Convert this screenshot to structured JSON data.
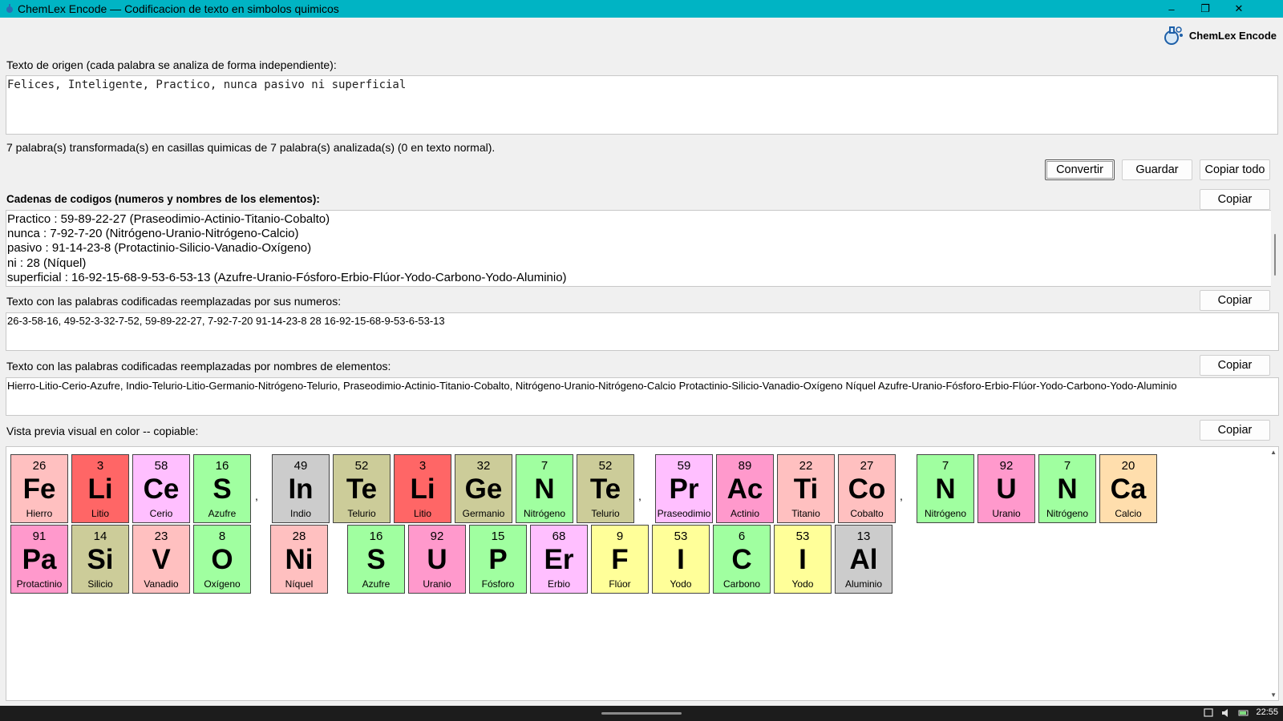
{
  "window": {
    "title": "ChemLex Encode — Codificacion de texto en simbolos quimicos",
    "controls": {
      "minimize": "–",
      "maximize": "❐",
      "close": "✕"
    }
  },
  "brand": {
    "name": "ChemLex Encode"
  },
  "source": {
    "label": "Texto de origen (cada palabra se analiza de forma independiente):",
    "value": "Felices, Inteligente, Practico, nunca pasivo ni superficial"
  },
  "status": "7 palabra(s) transformada(s) en casillas quimicas de 7 palabra(s) analizada(s) (0 en texto normal).",
  "buttons": {
    "convert": "Convertir",
    "save": "Guardar",
    "copy_all": "Copiar todo",
    "copy": "Copiar"
  },
  "codes": {
    "label": "Cadenas de codigos (numeros y nombres de los elementos):",
    "lines": [
      "Practico : 59-89-22-27  (Praseodimio-Actinio-Titanio-Cobalto)",
      "nunca : 7-92-7-20  (Nitrógeno-Uranio-Nitrógeno-Calcio)",
      "pasivo : 91-14-23-8  (Protactinio-Silicio-Vanadio-Oxígeno)",
      "ni : 28  (Níquel)",
      "superficial : 16-92-15-68-9-53-6-53-13  (Azufre-Uranio-Fósforo-Erbio-Flúor-Yodo-Carbono-Yodo-Aluminio)"
    ]
  },
  "numbers_text": {
    "label": "Texto con las palabras codificadas reemplazadas por sus numeros:",
    "value": "26-3-58-16, 49-52-3-32-7-52, 59-89-22-27, 7-92-7-20 91-14-23-8 28 16-92-15-68-9-53-6-53-13"
  },
  "names_text": {
    "label": "Texto con las palabras codificadas reemplazadas por nombres de elementos:",
    "value": "Hierro-Litio-Cerio-Azufre, Indio-Telurio-Litio-Germanio-Nitrógeno-Telurio, Praseodimio-Actinio-Titanio-Cobalto, Nitrógeno-Uranio-Nitrógeno-Calcio Protactinio-Silicio-Vanadio-Oxígeno Níquel Azufre-Uranio-Fósforo-Erbio-Flúor-Yodo-Carbono-Yodo-Aluminio"
  },
  "preview": {
    "label": "Vista previa visual en color -- copiable:",
    "colors": {
      "transition": "#ffc0c0",
      "alkali": "#ff6666",
      "lanthanide": "#ffbfff",
      "nonmetal": "#a0ffa0",
      "post_transition": "#cccccc",
      "metalloid": "#cccc99",
      "actinide": "#ff99cc",
      "alkaline_earth": "#ffdead",
      "halogen": "#ffff99"
    },
    "rows": [
      [
        {
          "n": "26",
          "s": "Fe",
          "e": "Hierro",
          "c": "transition"
        },
        {
          "n": "3",
          "s": "Li",
          "e": "Litio",
          "c": "alkali"
        },
        {
          "n": "58",
          "s": "Ce",
          "e": "Cerio",
          "c": "lanthanide"
        },
        {
          "n": "16",
          "s": "S",
          "e": "Azufre",
          "c": "nonmetal"
        },
        {
          "p": ","
        },
        {
          "n": "49",
          "s": "In",
          "e": "Indio",
          "c": "post_transition"
        },
        {
          "n": "52",
          "s": "Te",
          "e": "Telurio",
          "c": "metalloid"
        },
        {
          "n": "3",
          "s": "Li",
          "e": "Litio",
          "c": "alkali"
        },
        {
          "n": "32",
          "s": "Ge",
          "e": "Germanio",
          "c": "metalloid"
        },
        {
          "n": "7",
          "s": "N",
          "e": "Nitrógeno",
          "c": "nonmetal"
        },
        {
          "n": "52",
          "s": "Te",
          "e": "Telurio",
          "c": "metalloid"
        },
        {
          "p": ","
        },
        {
          "n": "59",
          "s": "Pr",
          "e": "Praseodimio",
          "c": "lanthanide"
        },
        {
          "n": "89",
          "s": "Ac",
          "e": "Actinio",
          "c": "actinide"
        },
        {
          "n": "22",
          "s": "Ti",
          "e": "Titanio",
          "c": "transition"
        },
        {
          "n": "27",
          "s": "Co",
          "e": "Cobalto",
          "c": "transition"
        },
        {
          "p": ","
        },
        {
          "n": "7",
          "s": "N",
          "e": "Nitrógeno",
          "c": "nonmetal"
        },
        {
          "n": "92",
          "s": "U",
          "e": "Uranio",
          "c": "actinide"
        },
        {
          "n": "7",
          "s": "N",
          "e": "Nitrógeno",
          "c": "nonmetal"
        },
        {
          "n": "20",
          "s": "Ca",
          "e": "Calcio",
          "c": "alkaline_earth"
        }
      ],
      [
        {
          "n": "91",
          "s": "Pa",
          "e": "Protactinio",
          "c": "actinide"
        },
        {
          "n": "14",
          "s": "Si",
          "e": "Silicio",
          "c": "metalloid"
        },
        {
          "n": "23",
          "s": "V",
          "e": "Vanadio",
          "c": "transition"
        },
        {
          "n": "8",
          "s": "O",
          "e": "Oxígeno",
          "c": "nonmetal"
        },
        {
          "gap": true
        },
        {
          "n": "28",
          "s": "Ni",
          "e": "Níquel",
          "c": "transition"
        },
        {
          "gap": true
        },
        {
          "n": "16",
          "s": "S",
          "e": "Azufre",
          "c": "nonmetal"
        },
        {
          "n": "92",
          "s": "U",
          "e": "Uranio",
          "c": "actinide"
        },
        {
          "n": "15",
          "s": "P",
          "e": "Fósforo",
          "c": "nonmetal"
        },
        {
          "n": "68",
          "s": "Er",
          "e": "Erbio",
          "c": "lanthanide"
        },
        {
          "n": "9",
          "s": "F",
          "e": "Flúor",
          "c": "halogen"
        },
        {
          "n": "53",
          "s": "I",
          "e": "Yodo",
          "c": "halogen"
        },
        {
          "n": "6",
          "s": "C",
          "e": "Carbono",
          "c": "nonmetal"
        },
        {
          "n": "53",
          "s": "I",
          "e": "Yodo",
          "c": "halogen"
        },
        {
          "n": "13",
          "s": "Al",
          "e": "Aluminio",
          "c": "post_transition"
        }
      ]
    ]
  },
  "taskbar": {
    "clock": "22:55"
  }
}
